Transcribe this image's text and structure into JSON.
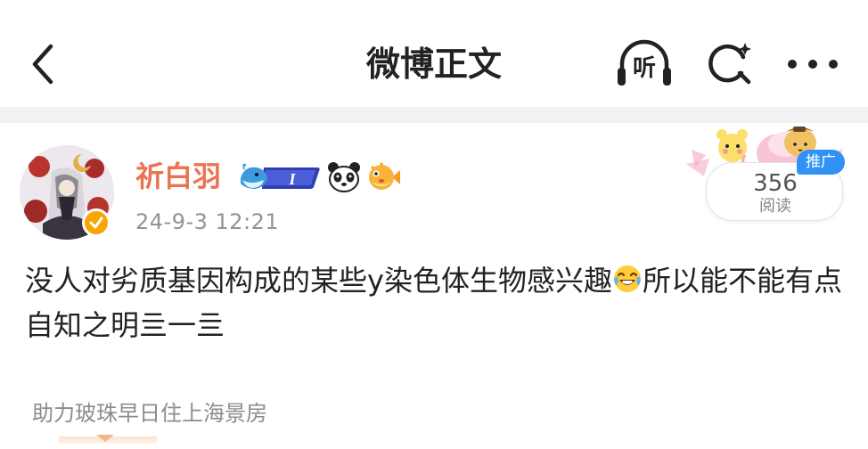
{
  "header": {
    "title": "微博正文",
    "listen_label": "听",
    "icons": {
      "back": "back-chevron-icon",
      "listen": "headphones-icon",
      "search": "search-icon",
      "more": "more-dots-icon"
    }
  },
  "post": {
    "username": "祈白羽",
    "username_color": "#eb7350",
    "timestamp": "24-9-3 12:21",
    "verified": true,
    "verify_color": "#f7a500",
    "member_badge_text": "I",
    "badge_icons": [
      "whale-member-badge-icon",
      "panda-icon",
      "pufferfish-icon"
    ],
    "text_part1": "没人对劣质基因构成的某些y染色体生物感兴趣",
    "emoji": "laughing-crying-emoji",
    "text_part2": "所以能不能有点自知之明亖一亖"
  },
  "ad": {
    "views": "356",
    "views_label": "阅读",
    "tag": "推广",
    "tag_color": "#2f93f6"
  },
  "footer": {
    "link_text": "助力玻珠早日住上海景房"
  }
}
